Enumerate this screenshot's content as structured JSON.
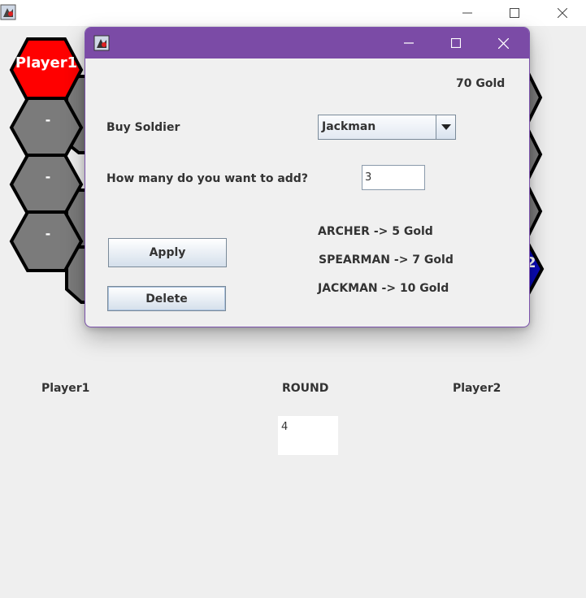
{
  "players": {
    "left_label": "Player1",
    "round_label": "ROUND",
    "right_label": "Player2",
    "round_value": "4"
  },
  "board": {
    "active_hex_label": "Player1",
    "empty_hex_label": "-",
    "right_edge_glyph": "2",
    "colors": {
      "player1_hex": "#ff0000",
      "player2_hex": "#0a0ab8",
      "empty_hex": "#7b7b7b",
      "hex_border": "#000000"
    }
  },
  "dialog": {
    "gold": "70 Gold",
    "buy_label": "Buy Soldier",
    "soldier_selected": "Jackman",
    "count_label": "How many do you want to add?",
    "count_value": "3",
    "apply_label": "Apply",
    "delete_label": "Delete",
    "prices": [
      "ARCHER -> 5 Gold",
      "SPEARMAN -> 7 Gold",
      "JACKMAN -> 10 Gold"
    ],
    "titlebar_color": "#7b4ba6"
  },
  "icons": [
    "app-icon",
    "minimize-icon",
    "maximize-icon",
    "close-icon",
    "dropdown-arrow-icon"
  ]
}
